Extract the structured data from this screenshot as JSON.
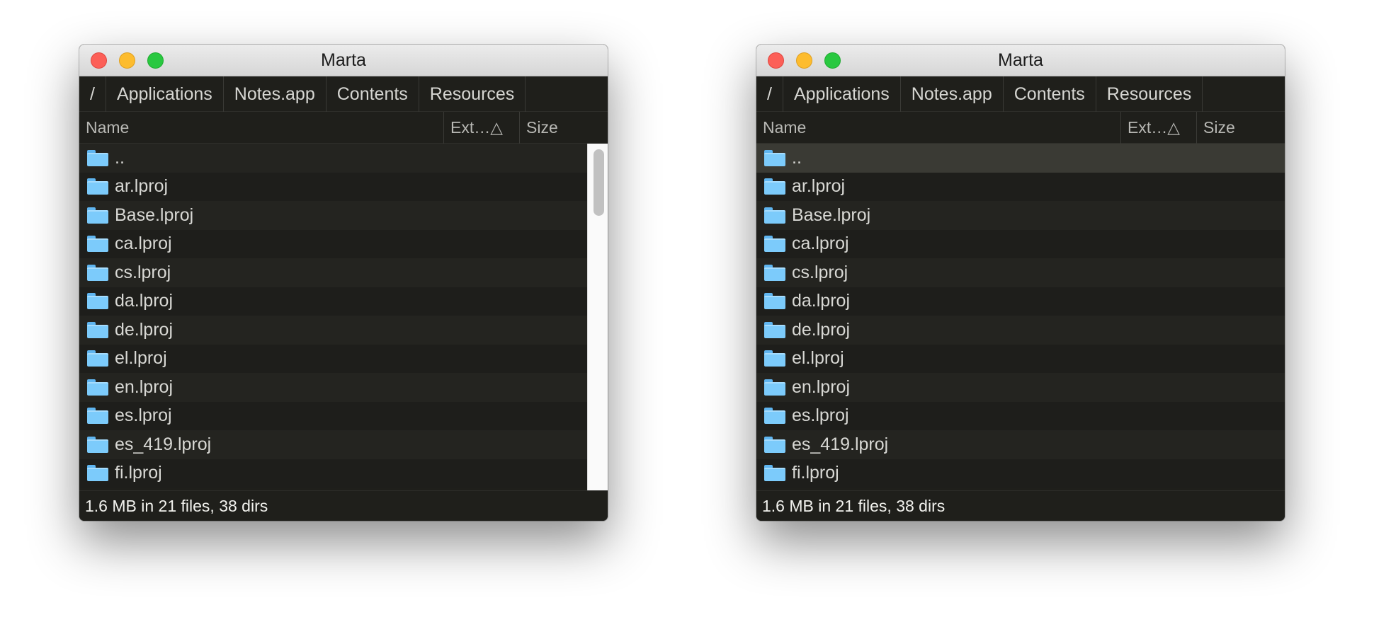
{
  "windows": [
    {
      "title": "Marta",
      "breadcrumb": [
        "/",
        "Applications",
        "Notes.app",
        "Contents",
        "Resources"
      ],
      "columns": {
        "name": "Name",
        "ext": "Ext…△",
        "size": "Size"
      },
      "rows": [
        {
          "name": "..",
          "icon": "folder-icon"
        },
        {
          "name": "ar.lproj",
          "icon": "folder-icon"
        },
        {
          "name": "Base.lproj",
          "icon": "folder-icon"
        },
        {
          "name": "ca.lproj",
          "icon": "folder-icon"
        },
        {
          "name": "cs.lproj",
          "icon": "folder-icon"
        },
        {
          "name": "da.lproj",
          "icon": "folder-icon"
        },
        {
          "name": "de.lproj",
          "icon": "folder-icon"
        },
        {
          "name": "el.lproj",
          "icon": "folder-icon"
        },
        {
          "name": "en.lproj",
          "icon": "folder-icon"
        },
        {
          "name": "es.lproj",
          "icon": "folder-icon"
        },
        {
          "name": "es_419.lproj",
          "icon": "folder-icon"
        },
        {
          "name": "fi.lproj",
          "icon": "folder-icon"
        }
      ],
      "scrollbar_visible": true,
      "selected_row_index": null,
      "status": "1.6 MB in 21 files, 38 dirs"
    },
    {
      "title": "Marta",
      "breadcrumb": [
        "/",
        "Applications",
        "Notes.app",
        "Contents",
        "Resources"
      ],
      "columns": {
        "name": "Name",
        "ext": "Ext…△",
        "size": "Size"
      },
      "rows": [
        {
          "name": "..",
          "icon": "folder-icon"
        },
        {
          "name": "ar.lproj",
          "icon": "folder-icon"
        },
        {
          "name": "Base.lproj",
          "icon": "folder-icon"
        },
        {
          "name": "ca.lproj",
          "icon": "folder-icon"
        },
        {
          "name": "cs.lproj",
          "icon": "folder-icon"
        },
        {
          "name": "da.lproj",
          "icon": "folder-icon"
        },
        {
          "name": "de.lproj",
          "icon": "folder-icon"
        },
        {
          "name": "el.lproj",
          "icon": "folder-icon"
        },
        {
          "name": "en.lproj",
          "icon": "folder-icon"
        },
        {
          "name": "es.lproj",
          "icon": "folder-icon"
        },
        {
          "name": "es_419.lproj",
          "icon": "folder-icon"
        },
        {
          "name": "fi.lproj",
          "icon": "folder-icon"
        }
      ],
      "scrollbar_visible": false,
      "selected_row_index": 0,
      "status": "1.6 MB in 21 files, 38 dirs"
    }
  ],
  "colors": {
    "window_bg": "#1f1f1b",
    "row_odd": "#242420",
    "row_even": "#1e1e1b",
    "row_selected": "#3a3a34",
    "folder": "#7ccbfb",
    "text": "#d8d8d4"
  }
}
